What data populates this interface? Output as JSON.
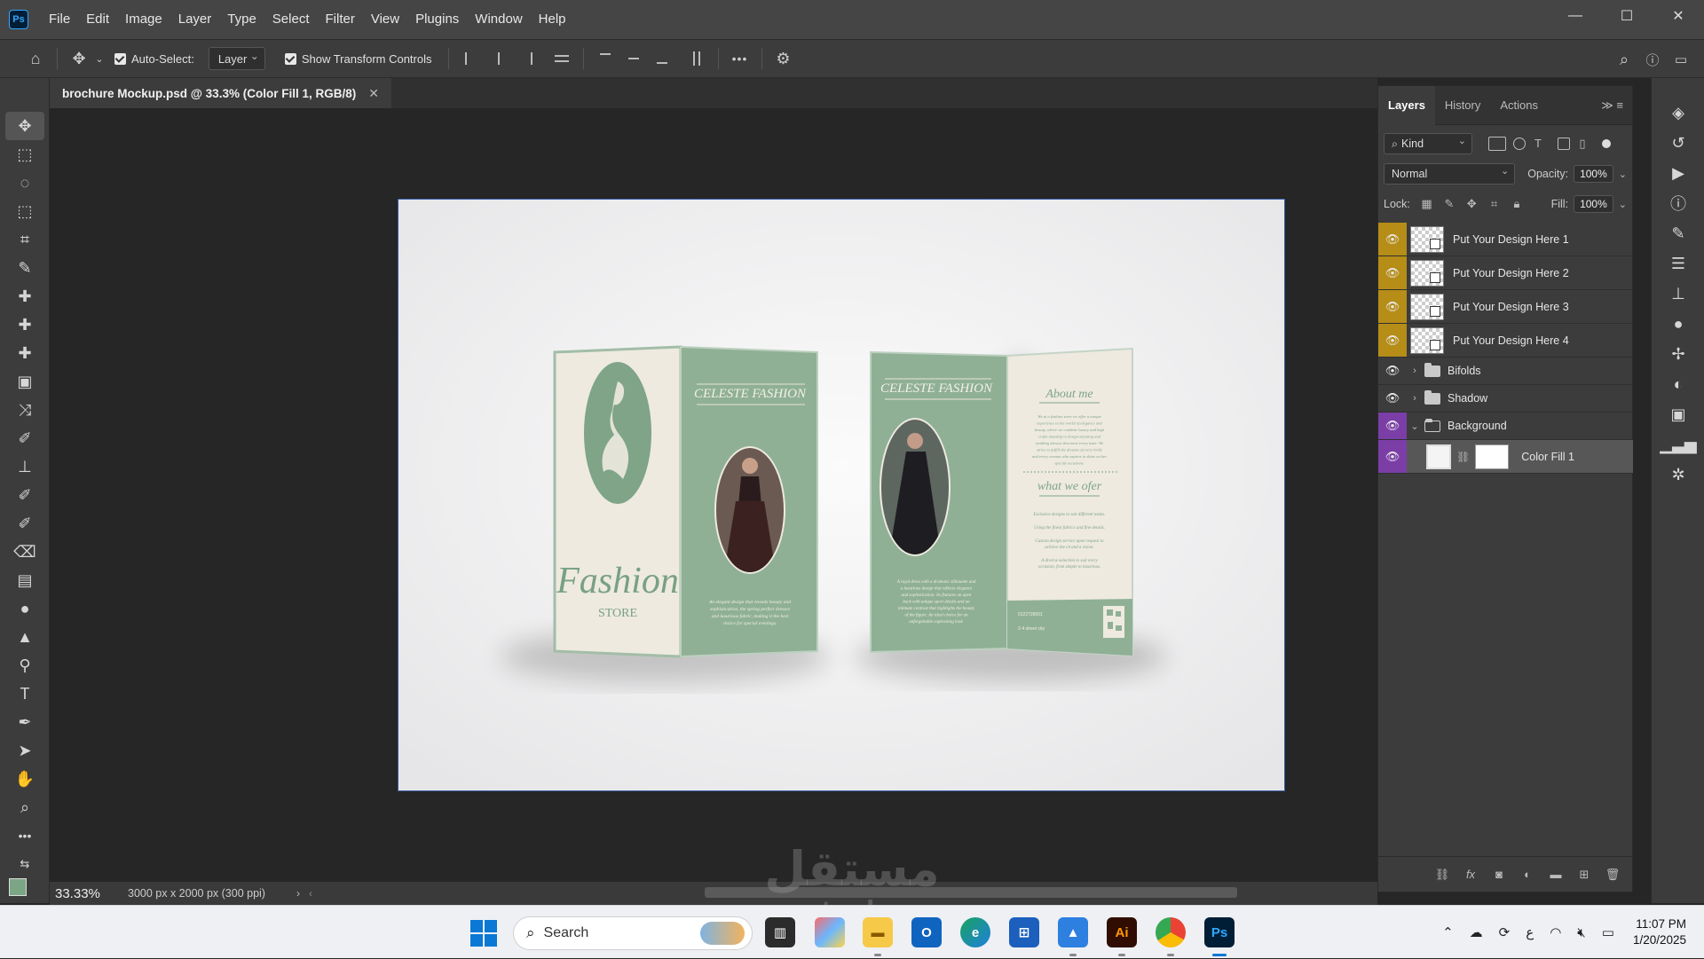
{
  "app": {
    "logo": "Ps",
    "menu": [
      "File",
      "Edit",
      "Image",
      "Layer",
      "Type",
      "Select",
      "Filter",
      "View",
      "Plugins",
      "Window",
      "Help"
    ],
    "window_controls": {
      "minimize": "—",
      "maximize": "☐",
      "close": "✕"
    }
  },
  "options": {
    "auto_select_label": "Auto-Select:",
    "auto_select_target": "Layer",
    "show_transform_label": "Show Transform Controls",
    "more": "•••"
  },
  "document": {
    "tab_title": "brochure Mockup.psd @ 33.3% (Color Fill 1, RGB/8)",
    "zoom": "33.33%",
    "info": "3000 px x 2000 px (300 ppi)"
  },
  "brochure": {
    "left": {
      "brand_big": "Fashion",
      "brand_small": "STORE",
      "panel_title": "CELESTE FASHION",
      "panel_blurb": "An elegant design that reveals beauty and sophistication, the spring perfect dresses and luxurious fabric, making it the best choice for special evenings."
    },
    "right": {
      "panel_title": "CELESTE FASHION",
      "panel_blurb": "A royal dress with a dramatic silhouette and a luxurious design that reflects elegance and sophistication. Its features an open back with unique sport details and an intimate contrast that highlights the beauty of the figure. An ideal choice for an unforgettable captivating look.",
      "about_heading": "About me",
      "about_text": "We at a fashion store we offer a unique experience to the world of elegance and beauty, where we combine luxury and high crafts manship to design stunning and wedding dresses that meet every taste. We strive to fulfill the dreams of every bride and every woman who aspires to shine on her special occasions.",
      "offer_heading": "what we ofer",
      "offer_items": [
        "Exclusive designs to suit different tastes.",
        "Using the finest fabrics and fine details.",
        "Custom design service upon request to achieve the ch and a vision.",
        "A diverse selection to suit every occasion, from simple to luxurious."
      ],
      "phone": "0122728001",
      "address": "2-4 street city"
    }
  },
  "layers_panel": {
    "tabs": [
      "Layers",
      "History",
      "Actions"
    ],
    "filter_kind": "Kind",
    "blend_mode": "Normal",
    "opacity_label": "Opacity:",
    "opacity": "100%",
    "lock_label": "Lock:",
    "fill_label": "Fill:",
    "fill": "100%",
    "layers": [
      {
        "name": "Put Your Design Here 1",
        "type": "smart",
        "color": "gold"
      },
      {
        "name": "Put Your Design Here 2",
        "type": "smart",
        "color": "gold"
      },
      {
        "name": "Put Your Design Here 3",
        "type": "smart",
        "color": "gold"
      },
      {
        "name": "Put Your Design Here 4",
        "type": "smart",
        "color": "gold"
      },
      {
        "name": "Bifolds",
        "type": "group",
        "expanded": false
      },
      {
        "name": "Shadow",
        "type": "group",
        "expanded": false
      },
      {
        "name": "Background",
        "type": "group",
        "expanded": true,
        "color": "violet"
      },
      {
        "name": "Color Fill 1",
        "type": "fill",
        "color": "violet",
        "selected": true
      }
    ]
  },
  "taskbar": {
    "search_placeholder": "Search",
    "time": "11:07 PM",
    "date": "1/20/2025",
    "ai_label": "Ai",
    "ps_label": "Ps"
  },
  "watermark": {
    "arabic": "مستقل",
    "latin": "mostaql.com"
  },
  "colors": {
    "brochure_green": "#8fb095",
    "brochure_cream": "#eeeae0",
    "accent_gold": "#b58d17",
    "accent_violet": "#7b3ea7"
  }
}
